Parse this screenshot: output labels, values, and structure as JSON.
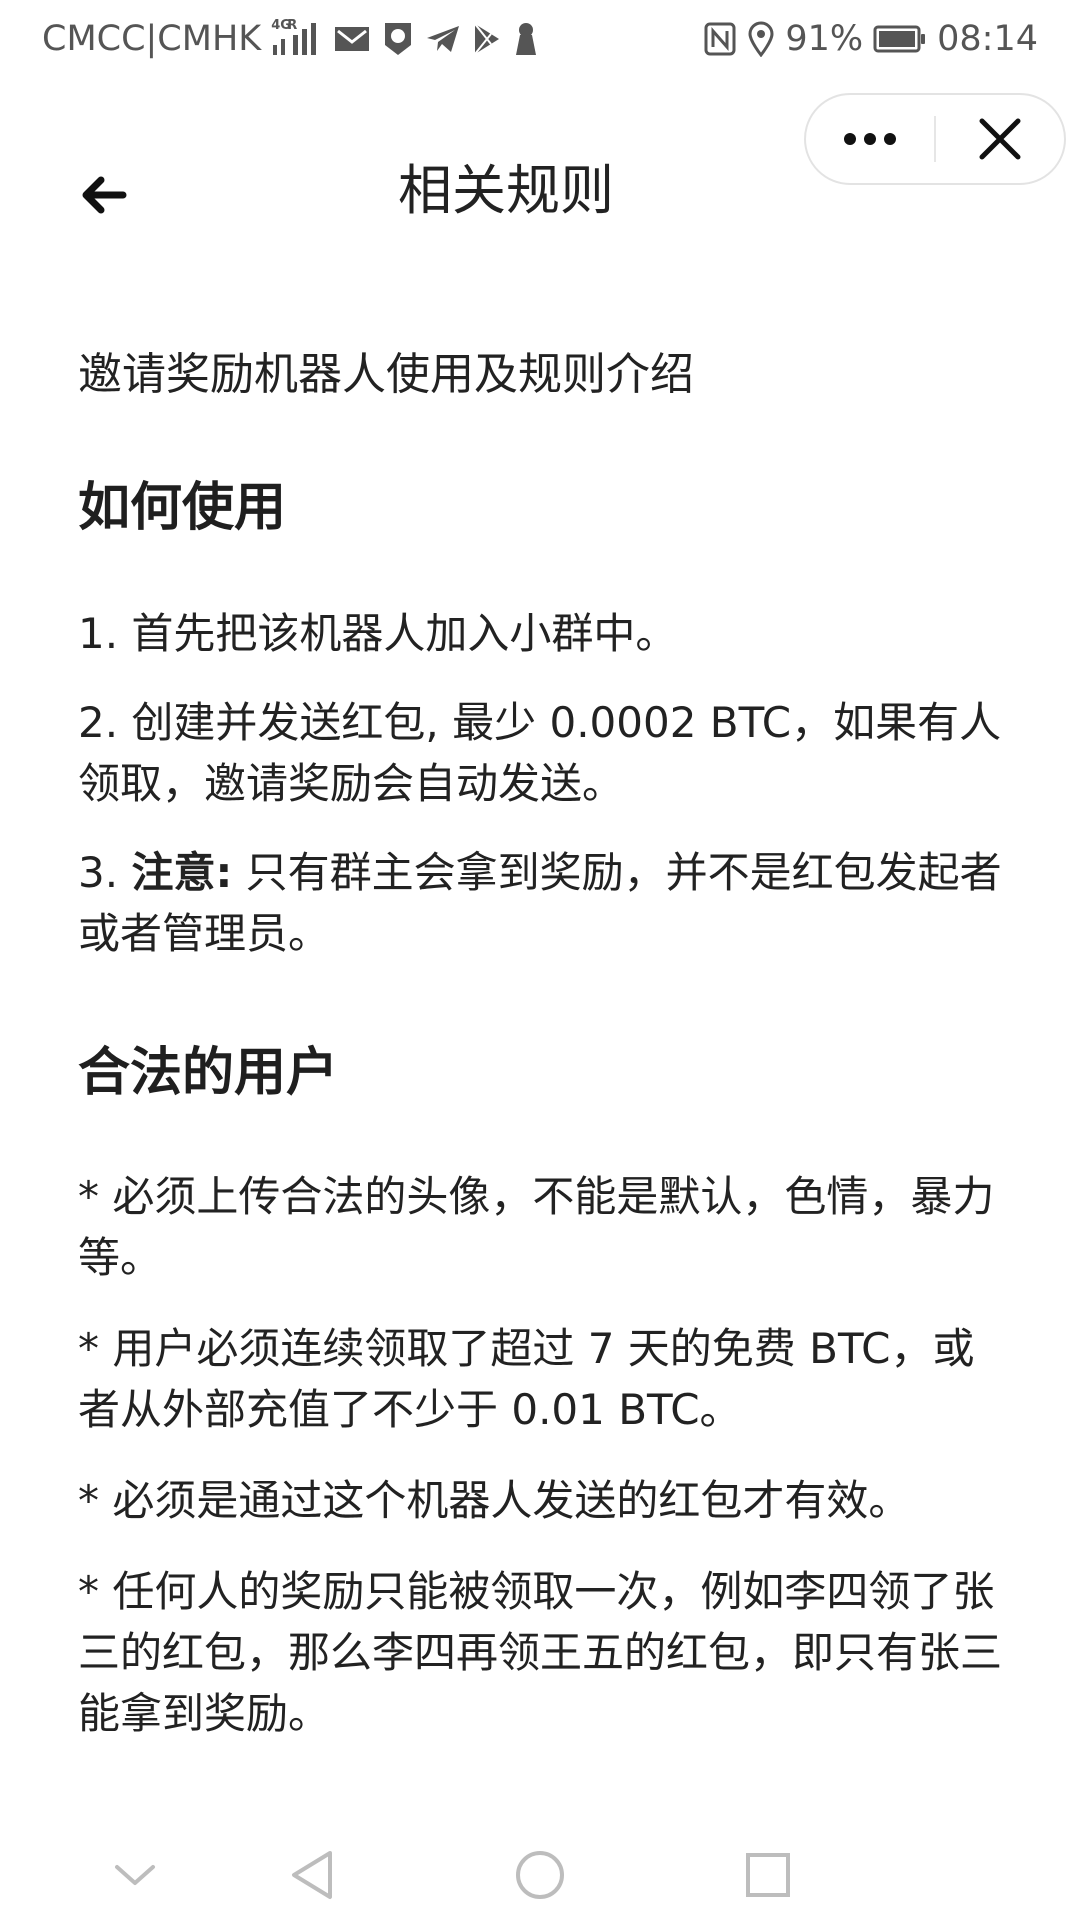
{
  "status_bar": {
    "carrier": "CMCC|CMHK",
    "network_badge_top": "4G",
    "network_badge_bottom": "R",
    "battery_percent": "91%",
    "time": "08:14"
  },
  "header": {
    "title": "相关规则"
  },
  "content": {
    "intro": "邀请奖励机器人使用及规则介绍",
    "section_usage": {
      "title": "如何使用",
      "step1": "1. 首先把该机器人加入小群中。",
      "step2": "2. 创建并发送红包, 最少 0.0002 BTC，如果有人领取，邀请奖励会自动发送。",
      "step3_prefix": "3. ",
      "step3_bold": "注意:",
      "step3_rest": " 只有群主会拿到奖励，并不是红包发起者或者管理员。"
    },
    "section_users": {
      "title": "合法的用户",
      "rule1": "* 必须上传合法的头像，不能是默认，色情，暴力等。",
      "rule2": "* 用户必须连续领取了超过 7 天的免费 BTC，或者从外部充值了不少于 0.01 BTC。",
      "rule3": "* 必须是通过这个机器人发送的红包才有效。",
      "rule4": "* 任何人的奖励只能被领取一次，例如李四领了张三的红包，那么李四再领王五的红包，即只有张三能拿到奖励。"
    }
  }
}
